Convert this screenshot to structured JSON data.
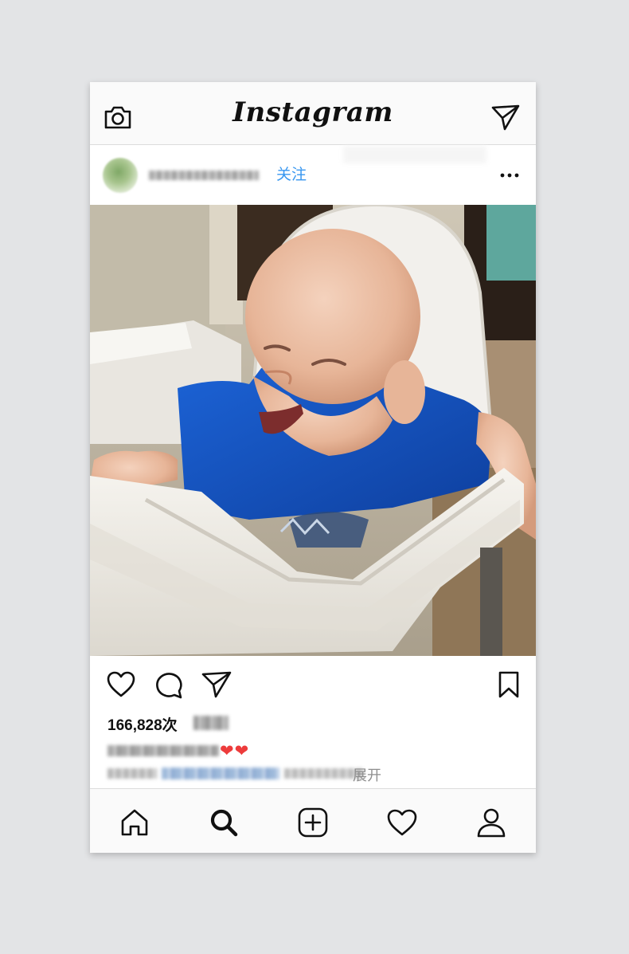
{
  "app": {
    "name": "Instagram"
  },
  "top_bar": {
    "camera_icon": "camera-icon",
    "direct_icon": "paper-plane-icon"
  },
  "post": {
    "follow_label": "关注",
    "more_icon": "more-dots-icon",
    "photo_alt": "Baby laughing in a white high chair, wearing a blue shirt",
    "views_label": "166,828次",
    "caption_hearts": "❤❤",
    "more_label": "展开"
  },
  "actions": {
    "like_icon": "heart-icon",
    "comment_icon": "comment-icon",
    "share_icon": "share-icon",
    "save_icon": "bookmark-icon"
  },
  "bottom_nav": {
    "items": [
      "home-icon",
      "search-icon",
      "add-post-icon",
      "activity-heart-icon",
      "profile-icon"
    ],
    "active": "search-icon"
  },
  "colors": {
    "accent": "#3897f0",
    "heart": "#ed3b3b",
    "background": "#e3e4e6"
  }
}
